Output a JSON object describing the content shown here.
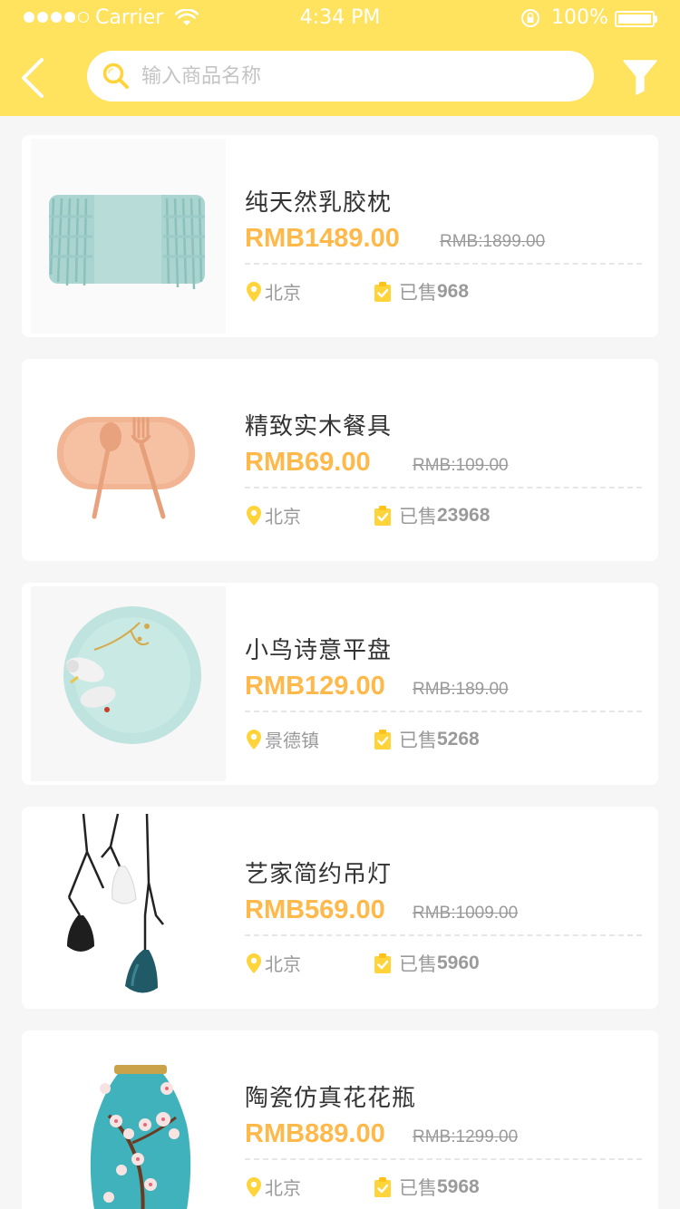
{
  "status_bar": {
    "carrier": "Carrier",
    "time": "4:34 PM",
    "battery": "100%"
  },
  "search": {
    "placeholder": "输入商品名称",
    "value": ""
  },
  "colors": {
    "header": "#ffe25e",
    "price": "#ffb94b",
    "muted": "#9a9a9a",
    "icon": "#ffd43b"
  },
  "products": [
    {
      "name": "纯天然乳胶枕",
      "price": "RMB1489.00",
      "original_price": "RMB:1899.00",
      "location": "北京",
      "sold_prefix": "已售",
      "sold_count": "968",
      "image_icon": "pillow-image"
    },
    {
      "name": "精致实木餐具",
      "price": "RMB69.00",
      "original_price": "RMB:109.00",
      "location": "北京",
      "sold_prefix": "已售",
      "sold_count": "23968",
      "image_icon": "cutlery-image"
    },
    {
      "name": "小鸟诗意平盘",
      "price": "RMB129.00",
      "original_price": "RMB:189.00",
      "location": "景德镇",
      "sold_prefix": "已售",
      "sold_count": "5268",
      "image_icon": "plate-image"
    },
    {
      "name": "艺家简约吊灯",
      "price": "RMB569.00",
      "original_price": "RMB:1009.00",
      "location": "北京",
      "sold_prefix": "已售",
      "sold_count": "5960",
      "image_icon": "lamp-image"
    },
    {
      "name": "陶瓷仿真花花瓶",
      "price": "RMB889.00",
      "original_price": "RMB:1299.00",
      "location": "北京",
      "sold_prefix": "已售",
      "sold_count": "5968",
      "image_icon": "vase-image"
    }
  ]
}
